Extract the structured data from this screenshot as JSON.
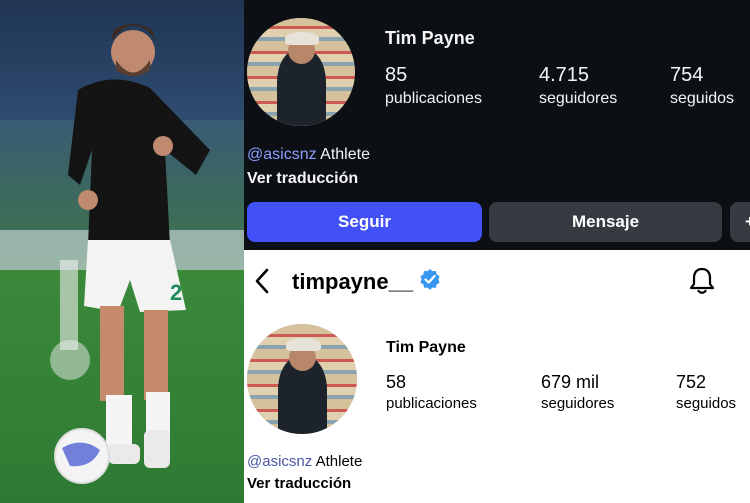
{
  "top_profile": {
    "name": "Tim Payne",
    "stats": [
      {
        "value": "85",
        "label": "publicaciones"
      },
      {
        "value": "4.715",
        "label": "seguidores"
      },
      {
        "value": "754",
        "label": "seguidos"
      }
    ],
    "bio_tag": "@asicsnz",
    "bio_text": "Athlete",
    "translate": "Ver traducción",
    "follow_button": "Seguir",
    "message_button": "Mensaje",
    "more_button": "+"
  },
  "bottom_profile": {
    "username": "timpayne__",
    "name": "Tim Payne",
    "stats": [
      {
        "value": "58",
        "label": "publicaciones"
      },
      {
        "value": "679 mil",
        "label": "seguidores"
      },
      {
        "value": "752",
        "label": "seguidos"
      }
    ],
    "bio_tag": "@asicsnz",
    "bio_text": "Athlete",
    "translate": "Ver traducción"
  },
  "icons": {
    "back": "chevron-left-icon",
    "verified": "verified-badge-icon",
    "notifications": "bell-icon"
  },
  "colors": {
    "follow_button": "#4150f7",
    "verified_badge": "#3897f0",
    "dark_bg": "#0c1014"
  }
}
